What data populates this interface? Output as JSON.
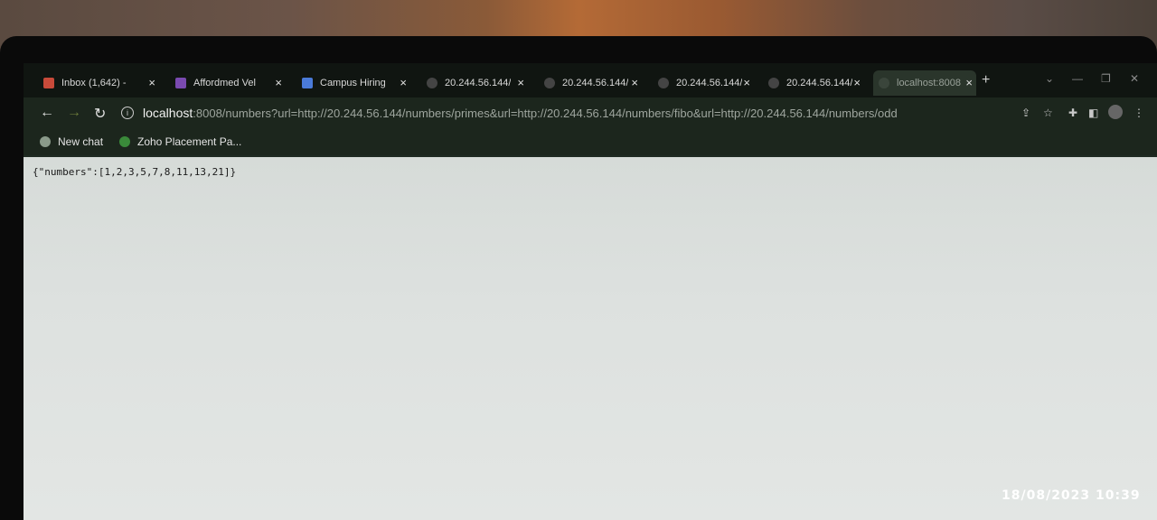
{
  "tabs": [
    {
      "title": "Inbox (1,642) -",
      "favicon": "gmail-icon",
      "active": false
    },
    {
      "title": "Affordmed Vel",
      "favicon": "forms-icon",
      "active": false
    },
    {
      "title": "Campus Hiring",
      "favicon": "docs-icon",
      "active": false
    },
    {
      "title": "20.244.56.144/",
      "favicon": "globe-icon",
      "active": false
    },
    {
      "title": "20.244.56.144/",
      "favicon": "globe-icon",
      "active": false
    },
    {
      "title": "20.244.56.144/",
      "favicon": "globe-icon",
      "active": false
    },
    {
      "title": "20.244.56.144/",
      "favicon": "globe-icon",
      "active": false
    },
    {
      "title": "localhost:8008",
      "favicon": "globe-icon",
      "active": true
    }
  ],
  "toolbar": {
    "url_host": "localhost",
    "url_rest": ":8008/numbers?url=http://20.244.56.144/numbers/primes&url=http://20.244.56.144/numbers/fibo&url=http://20.244.56.144/numbers/odd"
  },
  "bookmarks": [
    {
      "label": "New chat",
      "icon": "chatgpt-icon"
    },
    {
      "label": "Zoho Placement Pa...",
      "icon": "zoho-icon"
    }
  ],
  "page": {
    "json_text": "{\"numbers\":[1,2,3,5,7,8,11,13,21]}"
  },
  "overlay": {
    "timestamp": "18/08/2023  10:39"
  },
  "colors": {
    "page_bg": "#dde1df",
    "browser_chrome": "#1c261d"
  }
}
